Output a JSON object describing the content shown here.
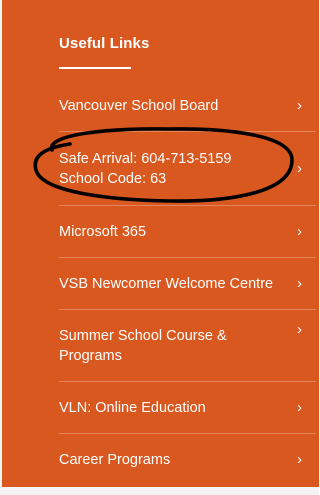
{
  "useful_links": {
    "heading": "Useful Links",
    "items": [
      {
        "label": "Vancouver School Board"
      },
      {
        "label": "Safe Arrival: 604-713-5159\nSchool Code: 63"
      },
      {
        "label": "Microsoft 365"
      },
      {
        "label": "VSB Newcomer Welcome Centre"
      },
      {
        "label": "Summer School Course & Programs"
      },
      {
        "label": "VLN: Online Education"
      },
      {
        "label": "Career Programs"
      }
    ],
    "chevron": "›"
  },
  "colors": {
    "background": "#d9581f",
    "text": "#ffffff",
    "annotation": "#000000"
  },
  "icons": {
    "chevron": "chevron-right-icon"
  }
}
